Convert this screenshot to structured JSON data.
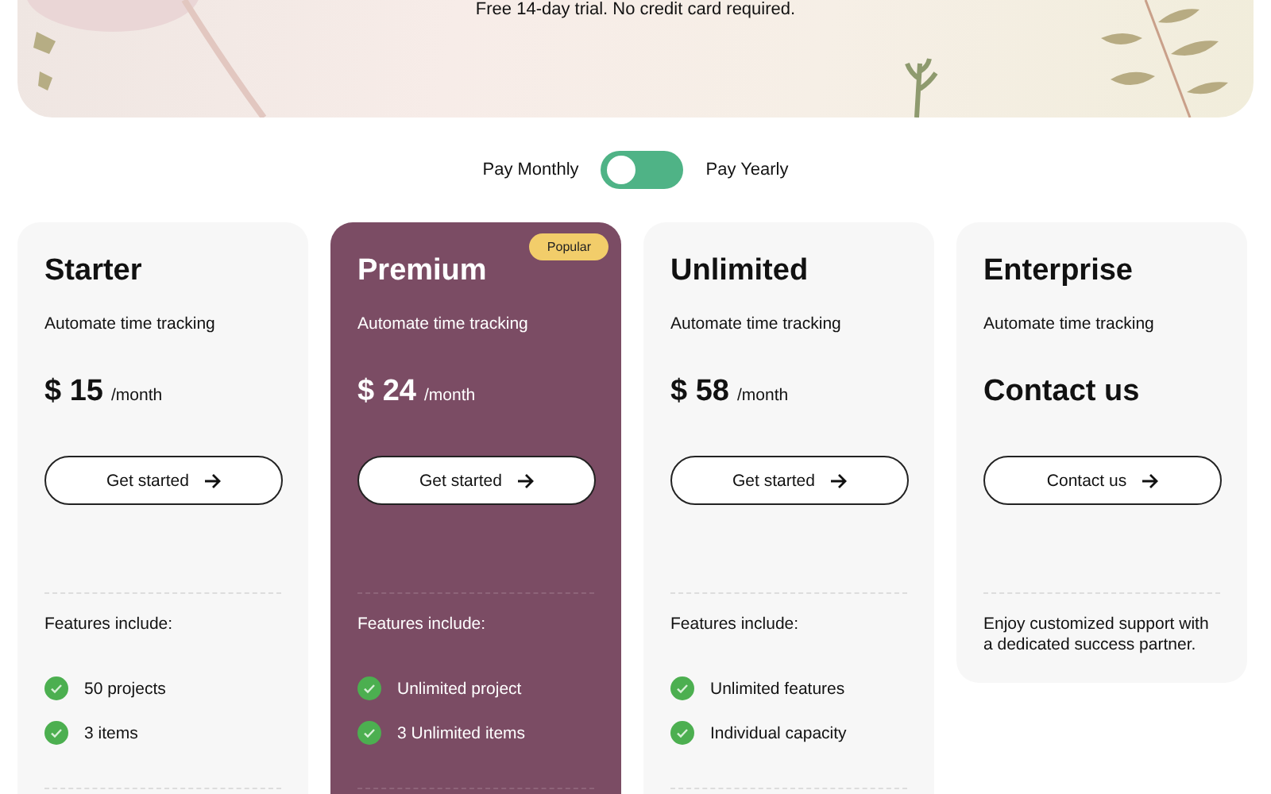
{
  "hero": {
    "subtitle": "Free 14-day trial. No credit card required."
  },
  "billing": {
    "left_label": "Pay Monthly",
    "right_label": "Pay Yearly",
    "on": false
  },
  "plans": [
    {
      "name": "Starter",
      "featured": false,
      "tagline": "Automate time tracking",
      "kind": "price",
      "price": "$ 15",
      "period": "/month",
      "button": "Get started",
      "features_title": "Features include:",
      "features": [
        "50 projects",
        "3 items"
      ]
    },
    {
      "name": "Premium",
      "featured": true,
      "badge": "Popular",
      "tagline": "Automate time tracking",
      "kind": "price",
      "price": "$ 24",
      "period": "/month",
      "button": "Get started",
      "features_title": "Features include:",
      "features": [
        "Unlimited project",
        "3 Unlimited items"
      ]
    },
    {
      "name": "Unlimited",
      "featured": false,
      "tagline": "Automate time tracking",
      "kind": "price",
      "price": "$ 58",
      "period": "/month",
      "button": "Get started",
      "features_title": "Features include:",
      "features": [
        "Unlimited features",
        "Individual capacity"
      ]
    },
    {
      "name": "Enterprise",
      "featured": false,
      "tagline": "Automate time tracking",
      "kind": "contact",
      "price": "Contact us",
      "button": "Contact us",
      "note": "Enjoy customized support with a dedicated success partner."
    }
  ]
}
